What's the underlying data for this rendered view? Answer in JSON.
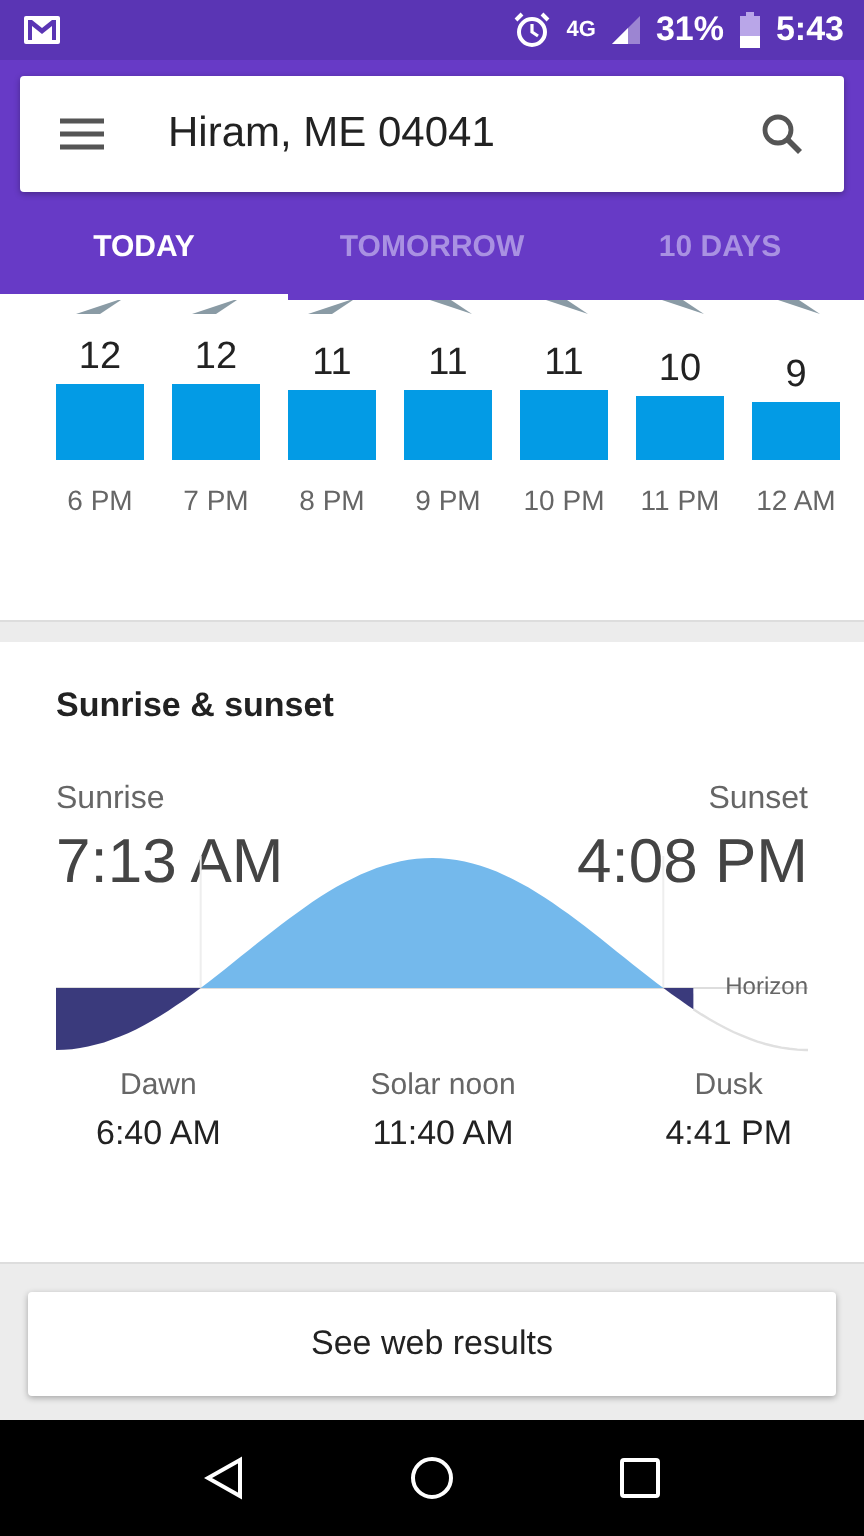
{
  "status_bar": {
    "battery": "31%",
    "time": "5:43",
    "network": "4G"
  },
  "search": {
    "value": "Hiram, ME 04041"
  },
  "tabs": [
    {
      "label": "TODAY",
      "selected": true
    },
    {
      "label": "TOMORROW",
      "selected": false
    },
    {
      "label": "10 DAYS",
      "selected": false
    }
  ],
  "hourly": [
    {
      "temp": "12",
      "time": "6 PM"
    },
    {
      "temp": "12",
      "time": "7 PM"
    },
    {
      "temp": "11",
      "time": "8 PM"
    },
    {
      "temp": "11",
      "time": "9 PM"
    },
    {
      "temp": "11",
      "time": "10 PM"
    },
    {
      "temp": "10",
      "time": "11 PM"
    },
    {
      "temp": "9",
      "time": "12 AM"
    }
  ],
  "sun": {
    "title": "Sunrise & sunset",
    "sunrise_label": "Sunrise",
    "sunrise": "7:13 AM",
    "sunset_label": "Sunset",
    "sunset": "4:08 PM",
    "horizon_label": "Horizon",
    "details": [
      {
        "label": "Dawn",
        "time": "6:40 AM"
      },
      {
        "label": "Solar noon",
        "time": "11:40 AM"
      },
      {
        "label": "Dusk",
        "time": "4:41 PM"
      }
    ]
  },
  "web_button": "See web results"
}
